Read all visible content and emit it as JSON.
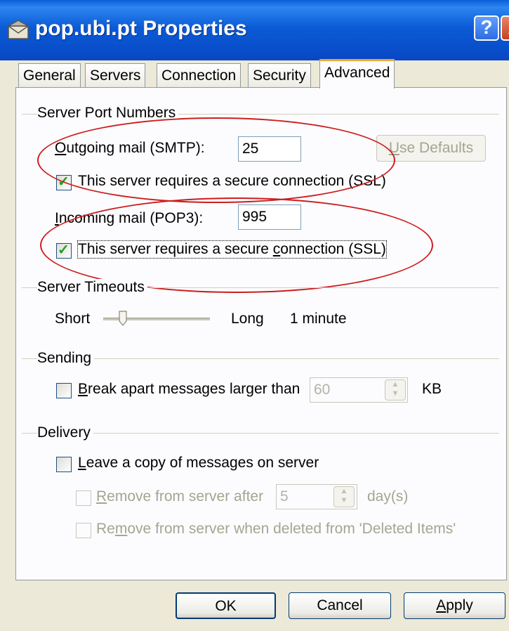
{
  "window": {
    "title": "pop.ubi.pt Properties",
    "help_glyph": "?",
    "close_glyph": "X"
  },
  "tabs": [
    "General",
    "Servers",
    "Connection",
    "Security",
    "Advanced"
  ],
  "active_tab": "Advanced",
  "ports": {
    "group_label": "Server Port Numbers",
    "outgoing_label_accel": "O",
    "outgoing_label_rest": "utgoing mail (SMTP):",
    "outgoing_value": "25",
    "use_defaults_label_accel": "U",
    "use_defaults_label_rest": "se Defaults",
    "smtp_ssl_label": "This server requires a secure connection (SSL)",
    "smtp_ssl_checked": true,
    "incoming_label_accel": "I",
    "incoming_label_rest": "ncoming mail (POP3):",
    "incoming_value": "995",
    "pop3_ssl_label_pre": "This server requires a secure ",
    "pop3_ssl_label_accel": "c",
    "pop3_ssl_label_post": "onnection (SSL)",
    "pop3_ssl_checked": true
  },
  "timeouts": {
    "group_label": "Server Timeouts",
    "short_label": "Short",
    "long_label": "Long",
    "value_label": "1 minute"
  },
  "sending": {
    "group_label": "Sending",
    "break_accel": "B",
    "break_rest": "reak apart messages larger than",
    "break_value": "60",
    "unit": "KB",
    "break_checked": false
  },
  "delivery": {
    "group_label": "Delivery",
    "leave_accel": "L",
    "leave_rest": "eave a copy of messages on server",
    "leave_checked": false,
    "remove_after_accel": "R",
    "remove_after_rest": "emove from server after",
    "remove_after_value": "5",
    "days_label": "day(s)",
    "remove_deleted_pre": "Re",
    "remove_deleted_accel": "m",
    "remove_deleted_post": "ove from server when deleted from 'Deleted Items'"
  },
  "buttons": {
    "ok": "OK",
    "cancel": "Cancel",
    "apply_accel": "A",
    "apply_rest": "pply"
  },
  "colors": {
    "title_bar": "#0a5fd8",
    "dialog_bg": "#ece9d8",
    "annotation": "#cc1f1f",
    "active_tab_accent": "#f0a830"
  }
}
